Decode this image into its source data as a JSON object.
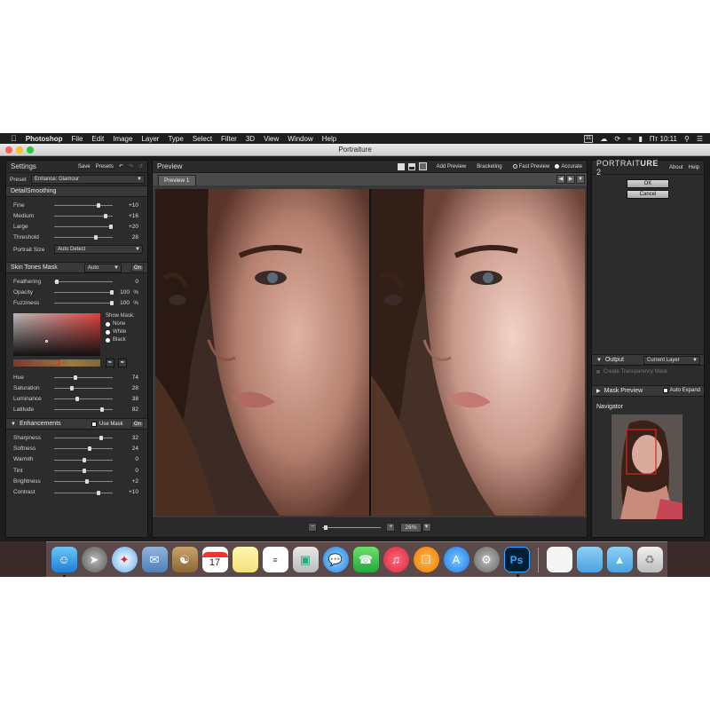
{
  "menubar": {
    "app": "Photoshop",
    "items": [
      "File",
      "Edit",
      "Image",
      "Layer",
      "Type",
      "Select",
      "Filter",
      "3D",
      "View",
      "Window",
      "Help"
    ],
    "calendar_badge": "31",
    "clock": "Пт 10:11"
  },
  "window": {
    "title": "Portraiture"
  },
  "settings": {
    "title": "Settings",
    "save_label": "Save",
    "presets_label": "Presets",
    "preset_label": "Preset",
    "preset_value": "Enhance: Glamour",
    "detail_smoothing_title": "DetailSmoothing",
    "detail_sliders": [
      {
        "label": "Fine",
        "value": "+10",
        "pos": 0.75
      },
      {
        "label": "Medium",
        "value": "+16",
        "pos": 0.88
      },
      {
        "label": "Large",
        "value": "+20",
        "pos": 0.97
      },
      {
        "label": "Threshold",
        "value": "28",
        "pos": 0.7
      }
    ],
    "portrait_size_label": "Portrait Size",
    "portrait_size_value": "Auto Detect",
    "skin_mask_title": "Skin Tones Mask",
    "skin_mask_mode": "Auto",
    "skin_mask_on": "On",
    "mask_sliders": [
      {
        "label": "Feathering",
        "value": "0",
        "pos": 0.02
      },
      {
        "label": "Opacity",
        "value": "100",
        "unit": "%",
        "pos": 0.98
      },
      {
        "label": "Fuzziness",
        "value": "100",
        "unit": "%",
        "pos": 0.98
      }
    ],
    "show_mask_label": "Show Mask:",
    "show_mask_options": [
      "None",
      "White",
      "Black"
    ],
    "tone_sliders": [
      {
        "label": "Hue",
        "value": "74",
        "pos": 0.35
      },
      {
        "label": "Saturation",
        "value": "28",
        "pos": 0.28
      },
      {
        "label": "Luminance",
        "value": "38",
        "pos": 0.38
      },
      {
        "label": "Latitude",
        "value": "82",
        "pos": 0.82
      }
    ],
    "enhancements_title": "Enhancements",
    "use_mask_label": "Use Mask",
    "enhancements_on": "On",
    "enh_sliders": [
      {
        "label": "Sharpness",
        "value": "32",
        "pos": 0.8
      },
      {
        "label": "Softness",
        "value": "24",
        "pos": 0.6
      },
      {
        "label": "Warmth",
        "value": "0",
        "pos": 0.5
      },
      {
        "label": "Tint",
        "value": "0",
        "pos": 0.5
      },
      {
        "label": "Brightness",
        "value": "+2",
        "pos": 0.55
      },
      {
        "label": "Contrast",
        "value": "+10",
        "pos": 0.75
      }
    ]
  },
  "preview": {
    "title": "Preview",
    "add_preview_label": "Add Preview",
    "bracketing_label": "Bracketing",
    "fast_preview_label": "Fast Preview",
    "accurate_label": "Accurate",
    "tab_label": "Preview 1",
    "zoom_value": "26%"
  },
  "right": {
    "logo_pre": "Portrait",
    "logo_post": "ure",
    "logo_ver": "2",
    "about_label": "About",
    "help_label": "Help",
    "ok_label": "OK",
    "cancel_label": "Cancel",
    "output_label": "Output",
    "output_value": "Current Layer",
    "transparency_label": "Create Transparency Mask",
    "mask_preview_label": "Mask Preview",
    "auto_expand_label": "Auto Expand",
    "navigator_label": "Navigator"
  },
  "dock": {
    "icons": [
      "finder-icon",
      "launchpad-icon",
      "safari-icon",
      "mail-icon",
      "contacts-icon",
      "calendar-icon",
      "notes-icon",
      "reminders-icon",
      "preview-icon",
      "messages-icon",
      "facetime-icon",
      "music-icon",
      "books-icon",
      "app-store-icon",
      "system-preferences-icon",
      "photoshop-icon",
      "documents-icon",
      "folder-icon",
      "applications-folder-icon",
      "trash-icon"
    ],
    "calendar_day": "17",
    "photoshop_label": "Ps"
  }
}
